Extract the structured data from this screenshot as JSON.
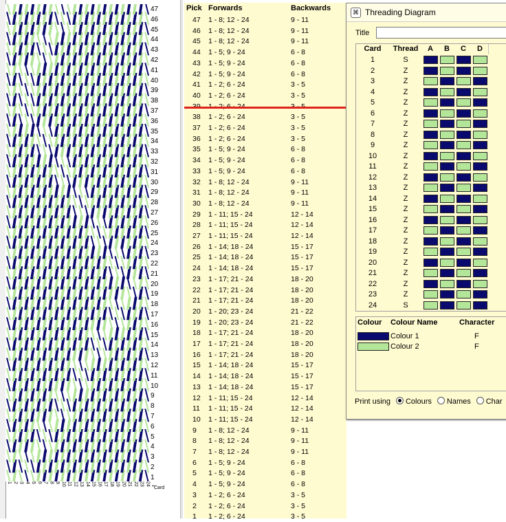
{
  "picks_header": {
    "pick": "Pick",
    "forwards": "Forwards",
    "backwards": "Backwards"
  },
  "picks": [
    {
      "pick": "47",
      "fwd": "1 - 8; 12 - 24",
      "bwd": "9 - 11"
    },
    {
      "pick": "46",
      "fwd": "1 - 8; 12 - 24",
      "bwd": "9 - 11"
    },
    {
      "pick": "45",
      "fwd": "1 - 8; 12 - 24",
      "bwd": "9 - 11"
    },
    {
      "pick": "44",
      "fwd": "1 - 5; 9 - 24",
      "bwd": "6 - 8"
    },
    {
      "pick": "43",
      "fwd": "1 - 5; 9 - 24",
      "bwd": "6 - 8"
    },
    {
      "pick": "42",
      "fwd": "1 - 5; 9 - 24",
      "bwd": "6 - 8"
    },
    {
      "pick": "41",
      "fwd": "1 - 2; 6 - 24",
      "bwd": "3 - 5"
    },
    {
      "pick": "40",
      "fwd": "1 - 2; 6 - 24",
      "bwd": "3 - 5"
    },
    {
      "pick": "39",
      "fwd": "1 - 2; 6 - 24",
      "bwd": "3 - 5"
    },
    {
      "pick": "38",
      "fwd": "1 - 2; 6 - 24",
      "bwd": "3 - 5"
    },
    {
      "pick": "37",
      "fwd": "1 - 2; 6 - 24",
      "bwd": "3 - 5"
    },
    {
      "pick": "36",
      "fwd": "1 - 2; 6 - 24",
      "bwd": "3 - 5"
    },
    {
      "pick": "35",
      "fwd": "1 - 5; 9 - 24",
      "bwd": "6 - 8"
    },
    {
      "pick": "34",
      "fwd": "1 - 5; 9 - 24",
      "bwd": "6 - 8"
    },
    {
      "pick": "33",
      "fwd": "1 - 5; 9 - 24",
      "bwd": "6 - 8"
    },
    {
      "pick": "32",
      "fwd": "1 - 8; 12 - 24",
      "bwd": "9 - 11"
    },
    {
      "pick": "31",
      "fwd": "1 - 8; 12 - 24",
      "bwd": "9 - 11"
    },
    {
      "pick": "30",
      "fwd": "1 - 8; 12 - 24",
      "bwd": "9 - 11"
    },
    {
      "pick": "29",
      "fwd": "1 - 11; 15 - 24",
      "bwd": "12 - 14"
    },
    {
      "pick": "28",
      "fwd": "1 - 11; 15 - 24",
      "bwd": "12 - 14"
    },
    {
      "pick": "27",
      "fwd": "1 - 11; 15 - 24",
      "bwd": "12 - 14"
    },
    {
      "pick": "26",
      "fwd": "1 - 14; 18 - 24",
      "bwd": "15 - 17"
    },
    {
      "pick": "25",
      "fwd": "1 - 14; 18 - 24",
      "bwd": "15 - 17"
    },
    {
      "pick": "24",
      "fwd": "1 - 14; 18 - 24",
      "bwd": "15 - 17"
    },
    {
      "pick": "23",
      "fwd": "1 - 17; 21 - 24",
      "bwd": "18 - 20"
    },
    {
      "pick": "22",
      "fwd": "1 - 17; 21 - 24",
      "bwd": "18 - 20"
    },
    {
      "pick": "21",
      "fwd": "1 - 17; 21 - 24",
      "bwd": "18 - 20"
    },
    {
      "pick": "20",
      "fwd": "1 - 20; 23 - 24",
      "bwd": "21 - 22"
    },
    {
      "pick": "19",
      "fwd": "1 - 20; 23 - 24",
      "bwd": "21 - 22"
    },
    {
      "pick": "18",
      "fwd": "1 - 17; 21 - 24",
      "bwd": "18 - 20"
    },
    {
      "pick": "17",
      "fwd": "1 - 17; 21 - 24",
      "bwd": "18 - 20"
    },
    {
      "pick": "16",
      "fwd": "1 - 17; 21 - 24",
      "bwd": "18 - 20"
    },
    {
      "pick": "15",
      "fwd": "1 - 14; 18 - 24",
      "bwd": "15 - 17"
    },
    {
      "pick": "14",
      "fwd": "1 - 14; 18 - 24",
      "bwd": "15 - 17"
    },
    {
      "pick": "13",
      "fwd": "1 - 14; 18 - 24",
      "bwd": "15 - 17"
    },
    {
      "pick": "12",
      "fwd": "1 - 11; 15 - 24",
      "bwd": "12 - 14"
    },
    {
      "pick": "11",
      "fwd": "1 - 11; 15 - 24",
      "bwd": "12 - 14"
    },
    {
      "pick": "10",
      "fwd": "1 - 11; 15 - 24",
      "bwd": "12 - 14"
    },
    {
      "pick": "9",
      "fwd": "1 - 8; 12 - 24",
      "bwd": "9 - 11"
    },
    {
      "pick": "8",
      "fwd": "1 - 8; 12 - 24",
      "bwd": "9 - 11"
    },
    {
      "pick": "7",
      "fwd": "1 - 8; 12 - 24",
      "bwd": "9 - 11"
    },
    {
      "pick": "6",
      "fwd": "1 - 5; 9 - 24",
      "bwd": "6 - 8"
    },
    {
      "pick": "5",
      "fwd": "1 - 5; 9 - 24",
      "bwd": "6 - 8"
    },
    {
      "pick": "4",
      "fwd": "1 - 5; 9 - 24",
      "bwd": "6 - 8"
    },
    {
      "pick": "3",
      "fwd": "1 - 2; 6 - 24",
      "bwd": "3 - 5"
    },
    {
      "pick": "2",
      "fwd": "1 - 2; 6 - 24",
      "bwd": "3 - 5"
    },
    {
      "pick": "1",
      "fwd": "1 - 2; 6 - 24",
      "bwd": "3 - 5"
    }
  ],
  "weave": {
    "card_word": "Card",
    "card_numbers": [
      "1",
      "2",
      "3",
      "4",
      "5",
      "6",
      "7",
      "8",
      "9",
      "10",
      "11",
      "12",
      "13",
      "14",
      "15",
      "16",
      "17",
      "18",
      "19",
      "20",
      "21",
      "22",
      "23",
      "24"
    ],
    "row_numbers": [
      "47",
      "46",
      "45",
      "44",
      "43",
      "42",
      "41",
      "40",
      "39",
      "38",
      "37",
      "36",
      "35",
      "34",
      "33",
      "32",
      "31",
      "30",
      "29",
      "28",
      "27",
      "26",
      "25",
      "24",
      "23",
      "22",
      "21",
      "20",
      "19",
      "18",
      "17",
      "16",
      "15",
      "14",
      "13",
      "12",
      "11",
      "10",
      "9",
      "8",
      "7",
      "6",
      "5",
      "4",
      "3",
      "2",
      "1"
    ],
    "colors": {
      "dark": "#0a0a6e",
      "light": "#b4e69a",
      "grid": "#ffffff"
    }
  },
  "threading_window": {
    "title": "Threading Diagram",
    "title_label": "Title",
    "title_value": "",
    "columns": [
      "Card",
      "Thread",
      "A",
      "B",
      "C",
      "D"
    ],
    "cards": [
      {
        "card": "1",
        "thread": "S",
        "holes": [
          "D",
          "L",
          "D",
          "L"
        ]
      },
      {
        "card": "2",
        "thread": "Z",
        "holes": [
          "D",
          "L",
          "D",
          "L"
        ]
      },
      {
        "card": "3",
        "thread": "Z",
        "holes": [
          "L",
          "D",
          "L",
          "D"
        ]
      },
      {
        "card": "4",
        "thread": "Z",
        "holes": [
          "D",
          "L",
          "D",
          "L"
        ]
      },
      {
        "card": "5",
        "thread": "Z",
        "holes": [
          "L",
          "D",
          "L",
          "D"
        ]
      },
      {
        "card": "6",
        "thread": "Z",
        "holes": [
          "D",
          "L",
          "D",
          "L"
        ]
      },
      {
        "card": "7",
        "thread": "Z",
        "holes": [
          "L",
          "D",
          "L",
          "D"
        ]
      },
      {
        "card": "8",
        "thread": "Z",
        "holes": [
          "D",
          "L",
          "D",
          "L"
        ]
      },
      {
        "card": "9",
        "thread": "Z",
        "holes": [
          "L",
          "D",
          "L",
          "D"
        ]
      },
      {
        "card": "10",
        "thread": "Z",
        "holes": [
          "D",
          "L",
          "D",
          "L"
        ]
      },
      {
        "card": "11",
        "thread": "Z",
        "holes": [
          "L",
          "D",
          "L",
          "D"
        ]
      },
      {
        "card": "12",
        "thread": "Z",
        "holes": [
          "D",
          "L",
          "D",
          "L"
        ]
      },
      {
        "card": "13",
        "thread": "Z",
        "holes": [
          "L",
          "D",
          "L",
          "D"
        ]
      },
      {
        "card": "14",
        "thread": "Z",
        "holes": [
          "D",
          "L",
          "D",
          "L"
        ]
      },
      {
        "card": "15",
        "thread": "Z",
        "holes": [
          "L",
          "D",
          "L",
          "D"
        ]
      },
      {
        "card": "16",
        "thread": "Z",
        "holes": [
          "D",
          "L",
          "D",
          "L"
        ]
      },
      {
        "card": "17",
        "thread": "Z",
        "holes": [
          "L",
          "D",
          "L",
          "D"
        ]
      },
      {
        "card": "18",
        "thread": "Z",
        "holes": [
          "D",
          "L",
          "D",
          "L"
        ]
      },
      {
        "card": "19",
        "thread": "Z",
        "holes": [
          "L",
          "D",
          "L",
          "D"
        ]
      },
      {
        "card": "20",
        "thread": "Z",
        "holes": [
          "D",
          "L",
          "D",
          "L"
        ]
      },
      {
        "card": "21",
        "thread": "Z",
        "holes": [
          "L",
          "D",
          "L",
          "D"
        ]
      },
      {
        "card": "22",
        "thread": "Z",
        "holes": [
          "D",
          "L",
          "D",
          "L"
        ]
      },
      {
        "card": "23",
        "thread": "Z",
        "holes": [
          "L",
          "D",
          "L",
          "D"
        ]
      },
      {
        "card": "24",
        "thread": "S",
        "holes": [
          "L",
          "D",
          "L",
          "D"
        ]
      }
    ],
    "colour_columns": [
      "Colour",
      "Colour Name",
      "Character"
    ],
    "colours": [
      {
        "hex": "#0a0a6e",
        "name": "Colour 1",
        "char": "F"
      },
      {
        "hex": "#b4e69a",
        "name": "Colour 2",
        "char": "F"
      }
    ],
    "print_using_label": "Print using",
    "print_options": [
      "Colours",
      "Names",
      "Char"
    ],
    "print_selected": "Colours"
  }
}
